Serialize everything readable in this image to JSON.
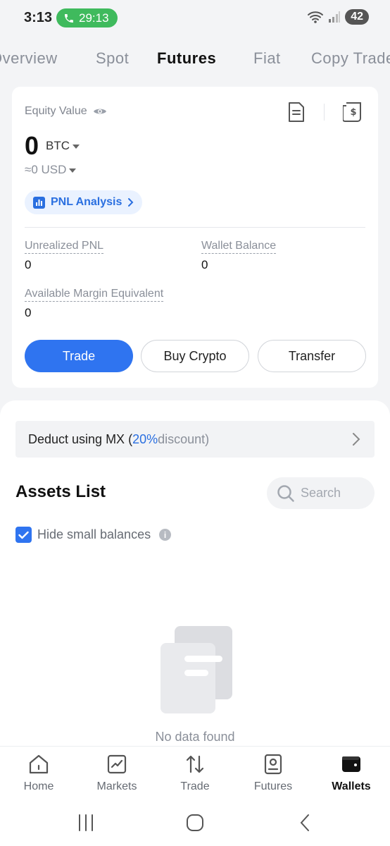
{
  "status_bar": {
    "time": "3:13",
    "call_timer": "29:13",
    "battery": "42"
  },
  "top_tabs": [
    {
      "label": "Overview",
      "active": false
    },
    {
      "label": "Spot",
      "active": false
    },
    {
      "label": "Futures",
      "active": true
    },
    {
      "label": "Fiat",
      "active": false
    },
    {
      "label": "Copy Trade",
      "active": false
    }
  ],
  "equity": {
    "label": "Equity Value",
    "value": "0",
    "unit": "BTC",
    "usd_value": "≈0 USD",
    "pnl_button": "PNL Analysis",
    "metrics": [
      {
        "label": "Unrealized PNL",
        "value": "0"
      },
      {
        "label": "Wallet Balance",
        "value": "0"
      },
      {
        "label": "Available Margin Equivalent",
        "value": "0"
      }
    ],
    "buttons": {
      "trade": "Trade",
      "buy": "Buy Crypto",
      "transfer": "Transfer"
    }
  },
  "deduct": {
    "prefix": "Deduct using MX (",
    "discount": "20%",
    "suffix": " discount)"
  },
  "assets": {
    "title": "Assets List",
    "search_placeholder": "Search",
    "hide_small_label": "Hide small balances",
    "hide_small_checked": true,
    "empty_text": "No data found"
  },
  "bottom_nav": [
    {
      "label": "Home",
      "icon": "home-icon",
      "active": false
    },
    {
      "label": "Markets",
      "icon": "chart-icon",
      "active": false
    },
    {
      "label": "Trade",
      "icon": "swap-arrows-icon",
      "active": false
    },
    {
      "label": "Futures",
      "icon": "futures-icon",
      "active": false
    },
    {
      "label": "Wallets",
      "icon": "wallet-icon",
      "active": true
    }
  ],
  "colors": {
    "accent": "#2f74f0",
    "call_green": "#3fba5d",
    "bg": "#f3f4f6"
  }
}
